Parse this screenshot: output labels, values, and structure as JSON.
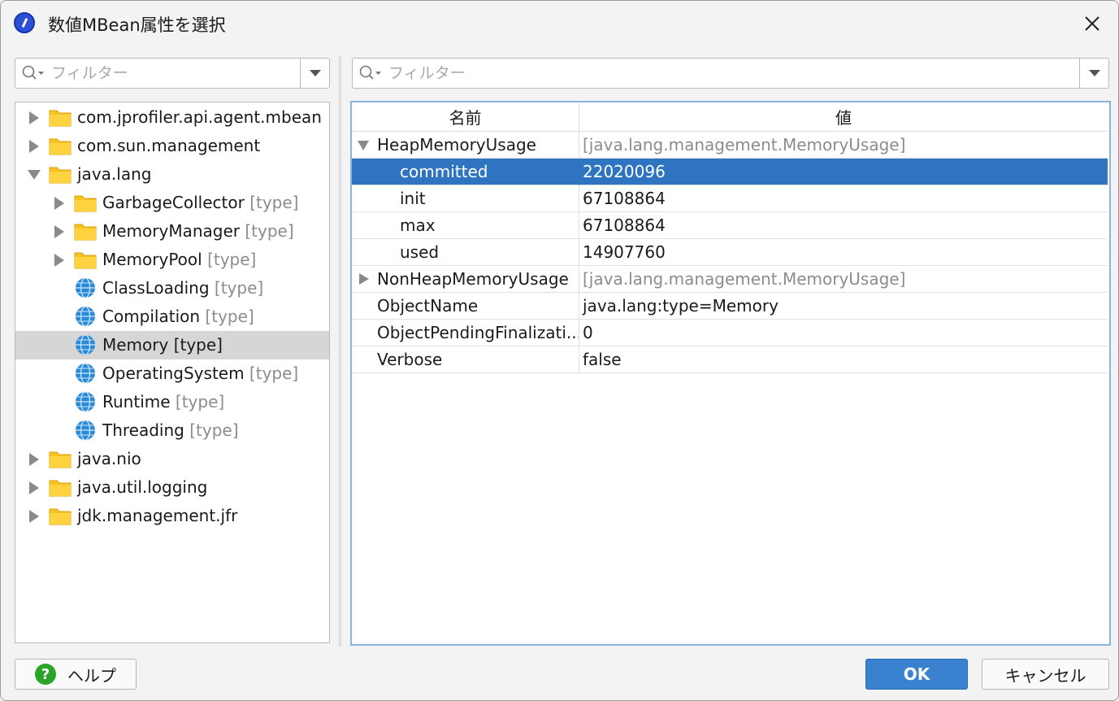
{
  "window": {
    "title": "数値MBean属性を選択"
  },
  "left_filter": {
    "placeholder": "フィルター"
  },
  "right_filter": {
    "placeholder": "フィルター"
  },
  "tree": {
    "nodes": [
      {
        "label": "com.jprofiler.api.agent.mbean",
        "tag": "",
        "expand": "collapsed",
        "icon": "folder-icon",
        "depth": 0
      },
      {
        "label": "com.sun.management",
        "tag": "",
        "expand": "collapsed",
        "icon": "folder-icon",
        "depth": 0
      },
      {
        "label": "java.lang",
        "tag": "",
        "expand": "expanded",
        "icon": "folder-icon",
        "depth": 0
      },
      {
        "label": "GarbageCollector",
        "tag": "[type]",
        "expand": "collapsed",
        "icon": "folder-icon",
        "depth": 1
      },
      {
        "label": "MemoryManager",
        "tag": "[type]",
        "expand": "collapsed",
        "icon": "folder-icon",
        "depth": 1
      },
      {
        "label": "MemoryPool",
        "tag": "[type]",
        "expand": "collapsed",
        "icon": "folder-icon",
        "depth": 1
      },
      {
        "label": "ClassLoading",
        "tag": "[type]",
        "expand": "none",
        "icon": "globe-icon",
        "depth": 1
      },
      {
        "label": "Compilation",
        "tag": "[type]",
        "expand": "none",
        "icon": "globe-icon",
        "depth": 1
      },
      {
        "label": "Memory [type]",
        "tag": "",
        "expand": "none",
        "icon": "globe-icon",
        "depth": 1,
        "selected": true
      },
      {
        "label": "OperatingSystem",
        "tag": "[type]",
        "expand": "none",
        "icon": "globe-icon",
        "depth": 1
      },
      {
        "label": "Runtime",
        "tag": "[type]",
        "expand": "none",
        "icon": "globe-icon",
        "depth": 1
      },
      {
        "label": "Threading",
        "tag": "[type]",
        "expand": "none",
        "icon": "globe-icon",
        "depth": 1
      },
      {
        "label": "java.nio",
        "tag": "",
        "expand": "collapsed",
        "icon": "folder-icon",
        "depth": 0
      },
      {
        "label": "java.util.logging",
        "tag": "",
        "expand": "collapsed",
        "icon": "folder-icon",
        "depth": 0
      },
      {
        "label": "jdk.management.jfr",
        "tag": "",
        "expand": "collapsed",
        "icon": "folder-icon",
        "depth": 0
      }
    ]
  },
  "table": {
    "columns": {
      "name": "名前",
      "value": "値"
    },
    "rows": [
      {
        "name": "HeapMemoryUsage",
        "value": "[java.lang.management.MemoryUsage]",
        "expand": "expanded",
        "indent": 0,
        "grey_value": true
      },
      {
        "name": "committed",
        "value": "22020096",
        "expand": "none",
        "indent": 1,
        "selected": true
      },
      {
        "name": "init",
        "value": "67108864",
        "expand": "none",
        "indent": 1
      },
      {
        "name": "max",
        "value": "67108864",
        "expand": "none",
        "indent": 1
      },
      {
        "name": "used",
        "value": "14907760",
        "expand": "none",
        "indent": 1
      },
      {
        "name": "NonHeapMemoryUsage",
        "value": "[java.lang.management.MemoryUsage]",
        "expand": "collapsed",
        "indent": 0,
        "grey_value": true
      },
      {
        "name": "ObjectName",
        "value": "java.lang:type=Memory",
        "expand": "none",
        "indent": 0
      },
      {
        "name": "ObjectPendingFinalizati...",
        "value": "0",
        "expand": "none",
        "indent": 0
      },
      {
        "name": "Verbose",
        "value": "false",
        "expand": "none",
        "indent": 0
      }
    ]
  },
  "buttons": {
    "help": "ヘルプ",
    "ok": "OK",
    "cancel": "キャンセル"
  },
  "colors": {
    "selection": "#2f74c0",
    "ok_button": "#3a82cf",
    "folder": "#f6c324",
    "globe": "#2a8ad8"
  }
}
